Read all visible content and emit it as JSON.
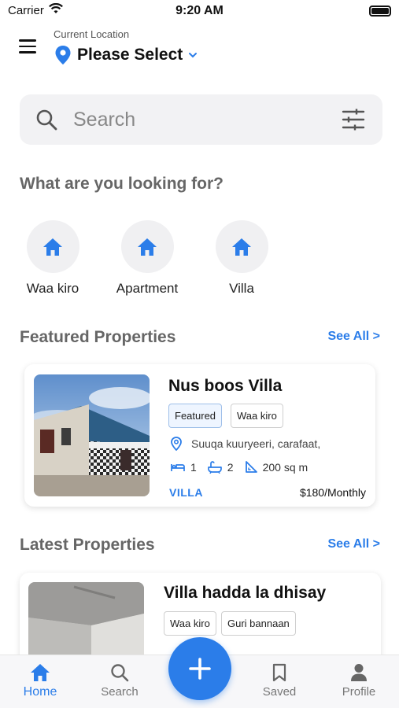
{
  "status_bar": {
    "carrier": "Carrier",
    "time": "9:20 AM"
  },
  "header": {
    "location_label": "Current Location",
    "location_value": "Please Select"
  },
  "search": {
    "placeholder": "Search"
  },
  "categories": {
    "title": "What are you looking for?",
    "items": [
      {
        "label": "Waa kiro",
        "icon": "home-icon"
      },
      {
        "label": "Apartment",
        "icon": "home-icon"
      },
      {
        "label": "Villa",
        "icon": "home-icon"
      }
    ]
  },
  "featured": {
    "title": "Featured Properties",
    "see_all": "See All >",
    "item": {
      "title": "Nus boos Villa",
      "tags": [
        "Featured",
        "Waa kiro"
      ],
      "address": "Suuqa kuuryeeri, carafaat,",
      "beds": "1",
      "baths": "2",
      "area": "200 sq m",
      "type": "VILLA",
      "price": "$180/Monthly"
    }
  },
  "latest": {
    "title": "Latest Properties",
    "see_all": "See All >",
    "item": {
      "title": "Villa hadda la dhisay",
      "tags": [
        "Waa kiro",
        "Guri bannaan"
      ]
    }
  },
  "tabbar": {
    "tabs": [
      {
        "label": "Home",
        "icon": "home-icon",
        "active": true
      },
      {
        "label": "Search",
        "icon": "search-icon",
        "active": false
      },
      {
        "label": "Saved",
        "icon": "bookmark-icon",
        "active": false
      },
      {
        "label": "Profile",
        "icon": "person-icon",
        "active": false
      }
    ],
    "fab_icon": "plus-icon"
  },
  "colors": {
    "accent": "#2b7de9",
    "muted_title": "#666666",
    "search_bg": "#f2f2f4"
  }
}
